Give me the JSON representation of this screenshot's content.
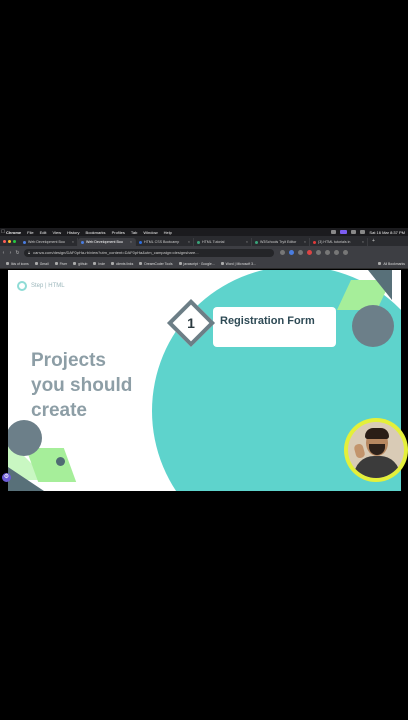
{
  "menubar": {
    "app_name": "Chrome",
    "items": [
      "File",
      "Edit",
      "View",
      "History",
      "Bookmarks",
      "Profiles",
      "Tab",
      "Window",
      "Help"
    ],
    "clock": "Sat 16 Mar 8:37 PM"
  },
  "tabs": [
    {
      "label": "Web Development Boo",
      "color": "#4a7de0",
      "active": false
    },
    {
      "label": "Web Development Boo",
      "color": "#4a7de0",
      "active": true
    },
    {
      "label": "HTML CSS Bootcamp",
      "color": "#2f6fe0",
      "active": false
    },
    {
      "label": "HTML Tutorial",
      "color": "#3aa37a",
      "active": false
    },
    {
      "label": "W3Schools Tryit Editor",
      "color": "#3aa37a",
      "active": false
    },
    {
      "label": "(3) HTML tutorials in",
      "color": "#e03a3a",
      "active": false
    }
  ],
  "address": {
    "url": "canva.com/design/DAF0pHa-rb/view?utm_content=DAF0pHa&utm_campaign=designshare..."
  },
  "bookmarks": [
    "Ikis of icons",
    "Gmail",
    "Fiver",
    "github",
    "Inde",
    "clients links",
    "DreamCoder Tools",
    "javascript · Google...",
    "Word | Microsoft 3..."
  ],
  "bookmarks_all": "All Bookmarks",
  "slide": {
    "logo_text": "Step | HTML",
    "heading_lines": [
      "Projects",
      "you should",
      "create"
    ],
    "step_number": "1",
    "step_label": "Registration Form"
  },
  "colors": {
    "teal": "#5ed3cc",
    "gray_text": "#8d9ea6",
    "accent_green": "#a6ee9a",
    "webcam_ring": "#e4f03a"
  },
  "icons": [
    "apple-icon",
    "back-icon",
    "forward-icon",
    "reload-icon",
    "lock-icon",
    "settings-gear-icon"
  ]
}
